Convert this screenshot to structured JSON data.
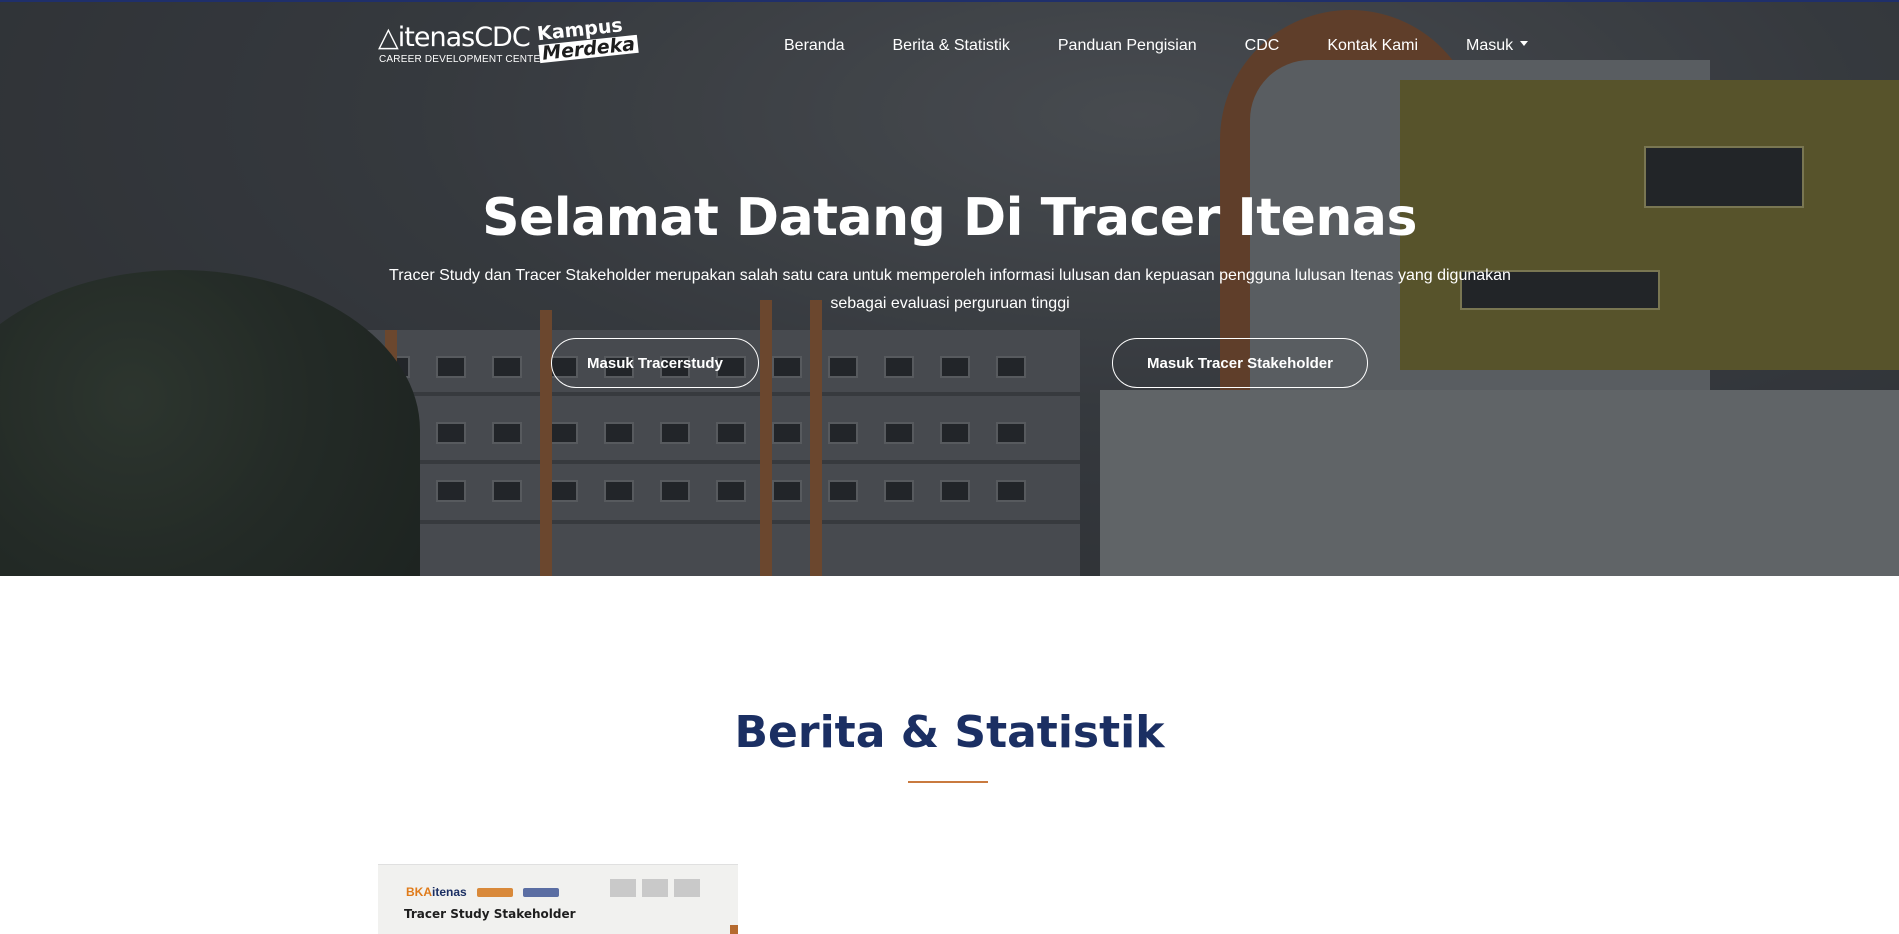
{
  "header": {
    "logo_text": "itenasCDC",
    "logo_sub": "CAREER DEVELOPMENT CENTER",
    "badge_line1": "Kampus",
    "badge_line2": "Merdeka"
  },
  "nav": {
    "items": [
      {
        "label": "Beranda"
      },
      {
        "label": "Berita & Statistik"
      },
      {
        "label": "Panduan Pengisian"
      },
      {
        "label": "CDC"
      },
      {
        "label": "Kontak Kami"
      },
      {
        "label": "Masuk"
      }
    ]
  },
  "hero": {
    "title": "Selamat Datang Di Tracer Itenas",
    "description": "Tracer Study dan Tracer Stakeholder merupakan salah satu cara untuk memperoleh informasi lulusan dan kepuasan pengguna lulusan Itenas yang digunakan sebagai evaluasi perguruan tinggi",
    "btn_tracerstudy": "Masuk Tracerstudy",
    "btn_stakeholder": "Masuk Tracer Stakeholder"
  },
  "section": {
    "title": "Berita & Statistik"
  },
  "card": {
    "brand": "BKA",
    "brand_suffix": "itenas",
    "title": "Tracer Study Stakeholder"
  },
  "colors": {
    "section_title": "#1b2f63",
    "accent_rule": "#c97a3f",
    "hero_text": "#ffffff"
  }
}
